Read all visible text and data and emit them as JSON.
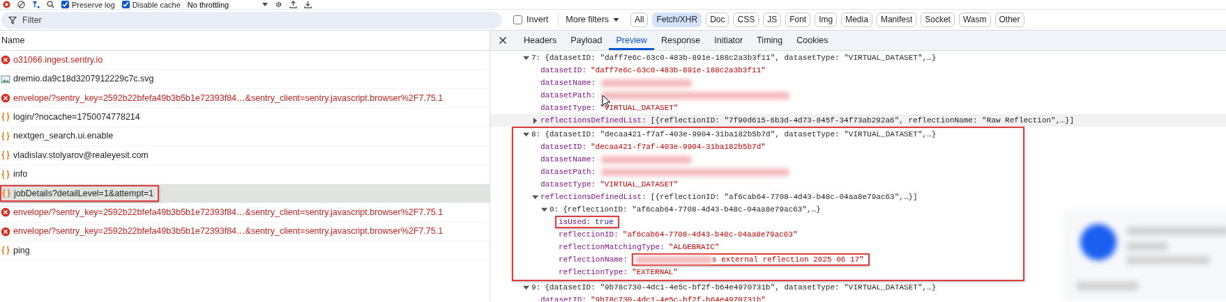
{
  "toolbar": {
    "preserve_log": {
      "label": "Preserve log",
      "checked": true
    },
    "disable_cache": {
      "label": "Disable cache",
      "checked": true
    },
    "throttling": "No throttling"
  },
  "filter_bar": {
    "placeholder": "Filter",
    "invert": {
      "label": "Invert",
      "checked": false
    },
    "more_filters": "More filters",
    "types": [
      {
        "label": "All",
        "selected": false
      },
      {
        "label": "Fetch/XHR",
        "selected": true
      },
      {
        "label": "Doc",
        "selected": false
      },
      {
        "label": "CSS",
        "selected": false
      },
      {
        "label": "JS",
        "selected": false
      },
      {
        "label": "Font",
        "selected": false
      },
      {
        "label": "Img",
        "selected": false
      },
      {
        "label": "Media",
        "selected": false
      },
      {
        "label": "Manifest",
        "selected": false
      },
      {
        "label": "Socket",
        "selected": false
      },
      {
        "label": "Wasm",
        "selected": false
      },
      {
        "label": "Other",
        "selected": false
      }
    ]
  },
  "requests": {
    "column": "Name",
    "rows": [
      {
        "name": "o31066.ingest.sentry.io",
        "kind": "error",
        "selected": false
      },
      {
        "name": "dremio.da9c18d3207912229c7c.svg",
        "kind": "image",
        "selected": false
      },
      {
        "name": "envelope/?sentry_key=2592b22bfefa49b3b5b1e72393f84…&sentry_client=sentry.javascript.browser%2F7.75.1",
        "kind": "error",
        "selected": false
      },
      {
        "name": "login/?nocache=1750074778214",
        "kind": "fetch",
        "selected": false
      },
      {
        "name": "nextgen_search.ui.enable",
        "kind": "fetch",
        "selected": false
      },
      {
        "name": "vladislav.stolyarov@realeyesit.com",
        "kind": "fetch",
        "selected": false
      },
      {
        "name": "info",
        "kind": "fetch",
        "selected": false
      },
      {
        "name": "jobDetails?detailLevel=1&attempt=1",
        "kind": "fetch",
        "selected": true,
        "annotated": true
      },
      {
        "name": "envelope/?sentry_key=2592b22bfefa49b3b5b1e72393f84…&sentry_client=sentry.javascript.browser%2F7.75.1",
        "kind": "error",
        "selected": false
      },
      {
        "name": "envelope/?sentry_key=2592b22bfefa49b3b5b1e72393f84…&sentry_client=sentry.javascript.browser%2F7.75.1",
        "kind": "error",
        "selected": false
      },
      {
        "name": "ping",
        "kind": "fetch",
        "selected": false
      }
    ]
  },
  "detail": {
    "tabs": [
      {
        "label": "Headers",
        "selected": false
      },
      {
        "label": "Payload",
        "selected": false
      },
      {
        "label": "Preview",
        "selected": true
      },
      {
        "label": "Response",
        "selected": false
      },
      {
        "label": "Initiator",
        "selected": false
      },
      {
        "label": "Timing",
        "selected": false
      },
      {
        "label": "Cookies",
        "selected": false
      }
    ],
    "tree": [
      {
        "kind": "index",
        "key": "7:",
        "summary": "{datasetID: \"daff7e6c-63c0-483b-891e-188c2a3b3f11\", datasetType: \"VIRTUAL_DATASET\",…}",
        "expanded": true,
        "children": [
          {
            "kind": "string",
            "key": "datasetID:",
            "value": "\"daff7e6c-63c0-483b-891e-188c2a3b3f11\""
          },
          {
            "kind": "redacted",
            "key": "datasetName:"
          },
          {
            "kind": "redacted",
            "key": "datasetPath:"
          },
          {
            "kind": "string",
            "key": "datasetType:",
            "value": "\"VIRTUAL_DATASET\""
          },
          {
            "kind": "property",
            "key": "reflectionsDefinedList:",
            "summary": "[{reflectionID: \"7f90d615-6b3d-4d73-845f-34f73ab292a6\", reflectionName: \"Raw Reflection\",…}]",
            "expanded": false,
            "hovered": true
          }
        ]
      },
      {
        "kind": "index",
        "key": "8:",
        "summary": "{datasetID: \"decaa421-f7af-403e-9904-31ba182b5b7d\", datasetType: \"VIRTUAL_DATASET\",…}",
        "expanded": true,
        "annotated": true,
        "children": [
          {
            "kind": "string",
            "key": "datasetID:",
            "value": "\"decaa421-f7af-403e-9904-31ba182b5b7d\""
          },
          {
            "kind": "redacted",
            "key": "datasetName:"
          },
          {
            "kind": "redacted",
            "key": "datasetPath:"
          },
          {
            "kind": "string",
            "key": "datasetType:",
            "value": "\"VIRTUAL_DATASET\""
          },
          {
            "kind": "property",
            "key": "reflectionsDefinedList:",
            "summary": "[{reflectionID: \"af6cab64-7708-4d43-b48c-04aa8e79ac63\",…}]",
            "expanded": true,
            "children": [
              {
                "kind": "index",
                "key": "0:",
                "summary": "{reflectionID: \"af6cab64-7708-4d43-b48c-04aa8e79ac63\",…}",
                "expanded": true,
                "children": [
                  {
                    "kind": "boolean",
                    "key": "isUsed:",
                    "value": "true",
                    "annotated": true
                  },
                  {
                    "kind": "string",
                    "key": "reflectionID:",
                    "value": "\"af6cab64-7708-4d43-b48c-04aa8e79ac63\""
                  },
                  {
                    "kind": "string",
                    "key": "reflectionMatchingType:",
                    "value": "\"ALGEBRAIC\""
                  },
                  {
                    "kind": "redacted",
                    "key": "reflectionName:",
                    "value": "s external reflection 2025 06 17\"",
                    "annotated": true
                  },
                  {
                    "kind": "string",
                    "key": "reflectionType:",
                    "value": "\"EXTERNAL\""
                  }
                ]
              }
            ]
          }
        ]
      },
      {
        "kind": "index",
        "key": "9:",
        "summary": "{datasetID: \"9b78c730-4dc1-4e5c-bf2f-b64e4970731b\", datasetType: \"VIRTUAL_DATASET\",…}",
        "expanded": true,
        "children": [
          {
            "kind": "string",
            "key": "datasetID:",
            "value": "\"9b78c730-4dc1-4e5c-bf2f-b64e4970731b\""
          }
        ]
      }
    ]
  }
}
